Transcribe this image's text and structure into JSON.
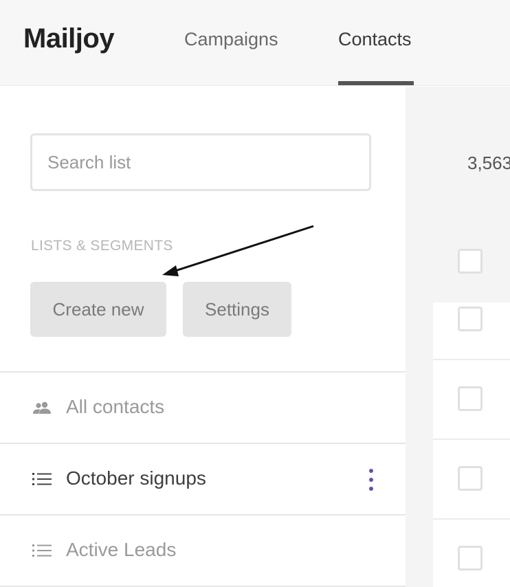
{
  "app": {
    "name": "Mailjoy"
  },
  "nav": {
    "tabs": [
      {
        "label": "Campaigns",
        "active": false
      },
      {
        "label": "Contacts",
        "active": true
      }
    ]
  },
  "sidebar": {
    "search": {
      "placeholder": "Search list",
      "value": ""
    },
    "section_label": "LISTS & SEGMENTS",
    "buttons": {
      "create": "Create new",
      "settings": "Settings"
    },
    "items": [
      {
        "label": "All contacts",
        "icon": "people-icon"
      },
      {
        "label": "October signups",
        "icon": "list-icon",
        "selected": true
      },
      {
        "label": "Active Leads",
        "icon": "list-icon"
      }
    ]
  },
  "main": {
    "count": "3,563"
  },
  "colors": {
    "accent": "#5a55b0",
    "button_bg": "#e4e4e4",
    "header_bg": "#f7f7f7"
  }
}
